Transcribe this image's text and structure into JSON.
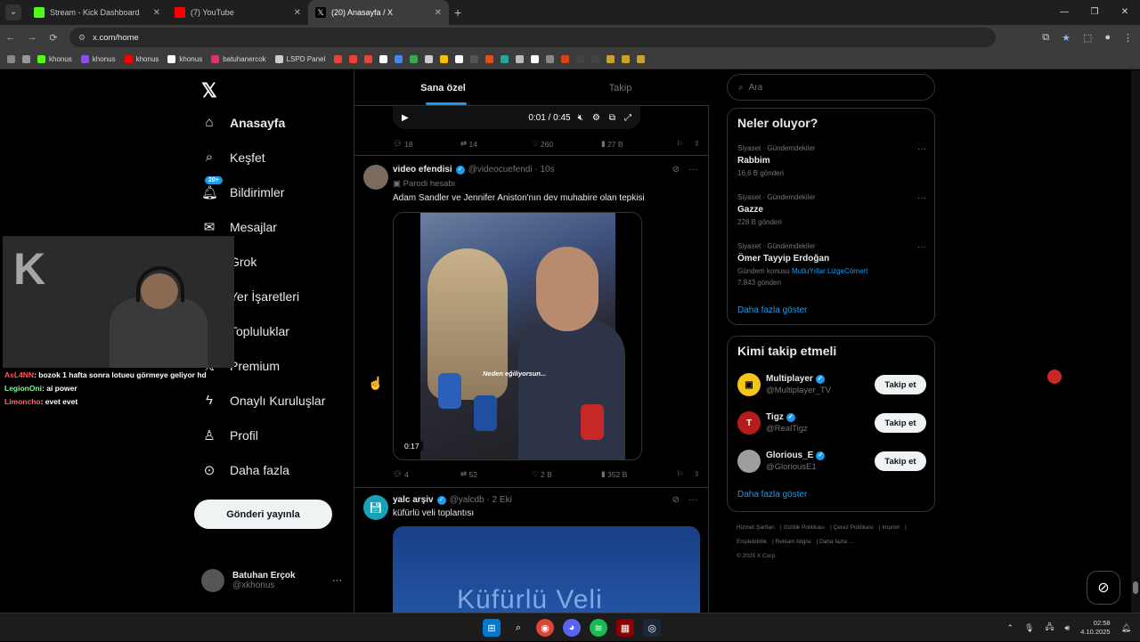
{
  "browser": {
    "tabs": [
      {
        "label": "Stream - Kick Dashboard",
        "color": "#53fc18"
      },
      {
        "label": "(7) YouTube",
        "color": "#ff0000"
      },
      {
        "label": "(20) Anasayfa / X",
        "color": "#000000"
      }
    ],
    "url": "x.com/home",
    "bookmarks": [
      "khonus",
      "khonus",
      "khonus",
      "khonus",
      "batuhanercok",
      "LSPD Panel"
    ]
  },
  "nav": {
    "items": [
      "Anasayfa",
      "Keşfet",
      "Bildirimler",
      "Mesajlar",
      "Grok",
      "Yer İşaretleri",
      "Topluluklar",
      "Premium",
      "Onaylı Kuruluşlar",
      "Profil",
      "Daha fazla"
    ],
    "notif_badge": "20+",
    "post_label": "Gönderi yayınla",
    "account_name": "Batuhan Erçok",
    "account_handle": "@xkhonus"
  },
  "stream_chat": [
    {
      "user": "AsL4NN",
      "msg": ": bozok 1 hafta sonra lotueu görmeye geliyor hd"
    },
    {
      "user": "LegionOni",
      "msg": ": ai power"
    },
    {
      "user": "Limoncho",
      "msg": ": evet evet"
    }
  ],
  "feed": {
    "tabs": [
      "Sana özel",
      "Takip"
    ],
    "player": {
      "time": "0:01 / 0:45"
    },
    "actions1": {
      "replies": "18",
      "reposts": "14",
      "likes": "260",
      "views": "27 B"
    },
    "tweet1": {
      "name": "video efendisi",
      "handle": "@videocuefendi · 10s",
      "parody": "Parodi hesabı",
      "text": "Adam Sandler ve Jennifer Aniston'nın dev muhabire olan tepkisi",
      "caption": "Neden eğiliyorsun...",
      "duration": "0:17",
      "replies": "4",
      "reposts": "52",
      "likes": "2 B",
      "views": "352 B"
    },
    "tweet2": {
      "name": "yalc arşiv",
      "handle": "@yalcdb · 2 Eki",
      "text": "küfürlü veli toplantısı",
      "media_text": "Küfürlü Veli"
    }
  },
  "sidebar": {
    "search_placeholder": "Ara",
    "trends_title": "Neler oluyor?",
    "trends": [
      {
        "category": "Siyaset · Gündemdekiler",
        "title": "Rabbim",
        "count": "16,6 B gönderi"
      },
      {
        "category": "Siyaset · Gündemdekiler",
        "title": "Gazze",
        "count": "228 B gönderi"
      },
      {
        "category": "Siyaset · Gündemdekiler",
        "title": "Ömer Tayyip Erdoğan",
        "context_prefix": "Gündem konusu",
        "context_tags": "MutluYıllar LizgeCömert",
        "count": "7.843 gönderi"
      }
    ],
    "show_more": "Daha fazla göster",
    "who_title": "Kimi takip etmeli",
    "who": [
      {
        "name": "Multiplayer",
        "handle": "@Multiplayer_TV",
        "color": "#f5c518"
      },
      {
        "name": "Tigz",
        "handle": "@RealTigz",
        "color": "#b71c1c"
      },
      {
        "name": "Glorious_E",
        "handle": "@GloriousE1",
        "color": "#9e9e9e"
      }
    ],
    "follow_label": "Takip et",
    "footer": [
      "Hizmet Şartları",
      "Gizlilik Politikası",
      "Çerez Politikası",
      "Imprint",
      "Erişilebilirlik",
      "Reklam bilgisi",
      "Daha fazla ...",
      "© 2025 X Corp."
    ]
  },
  "taskbar": {
    "time": "02:58",
    "date": "4.10.2025"
  }
}
